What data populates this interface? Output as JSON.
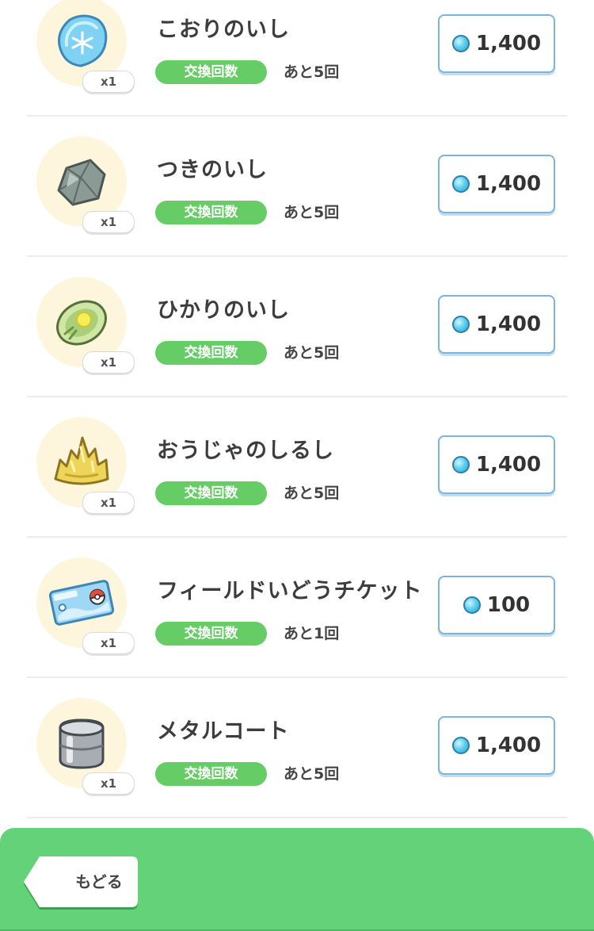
{
  "items": [
    {
      "name": "こおりのいし",
      "qty": "x1",
      "badge": "交換回数",
      "remaining": "あと5回",
      "price": "1,400",
      "icon": "ice-stone-icon"
    },
    {
      "name": "つきのいし",
      "qty": "x1",
      "badge": "交換回数",
      "remaining": "あと5回",
      "price": "1,400",
      "icon": "moon-stone-icon"
    },
    {
      "name": "ひかりのいし",
      "qty": "x1",
      "badge": "交換回数",
      "remaining": "あと5回",
      "price": "1,400",
      "icon": "shiny-stone-icon"
    },
    {
      "name": "おうじゃのしるし",
      "qty": "x1",
      "badge": "交換回数",
      "remaining": "あと5回",
      "price": "1,400",
      "icon": "kings-rock-icon"
    },
    {
      "name": "フィールドいどうチケット",
      "qty": "x1",
      "badge": "交換回数",
      "remaining": "あと1回",
      "price": "100",
      "icon": "field-ticket-icon"
    },
    {
      "name": "メタルコート",
      "qty": "x1",
      "badge": "交換回数",
      "remaining": "あと5回",
      "price": "1,400",
      "icon": "metal-coat-icon"
    }
  ],
  "footer": {
    "back_label": "もどる"
  },
  "colors": {
    "accent_green": "#64d279",
    "badge_green": "#66cc66",
    "button_border": "#7ab4df",
    "gem": "#5fd1f0"
  }
}
